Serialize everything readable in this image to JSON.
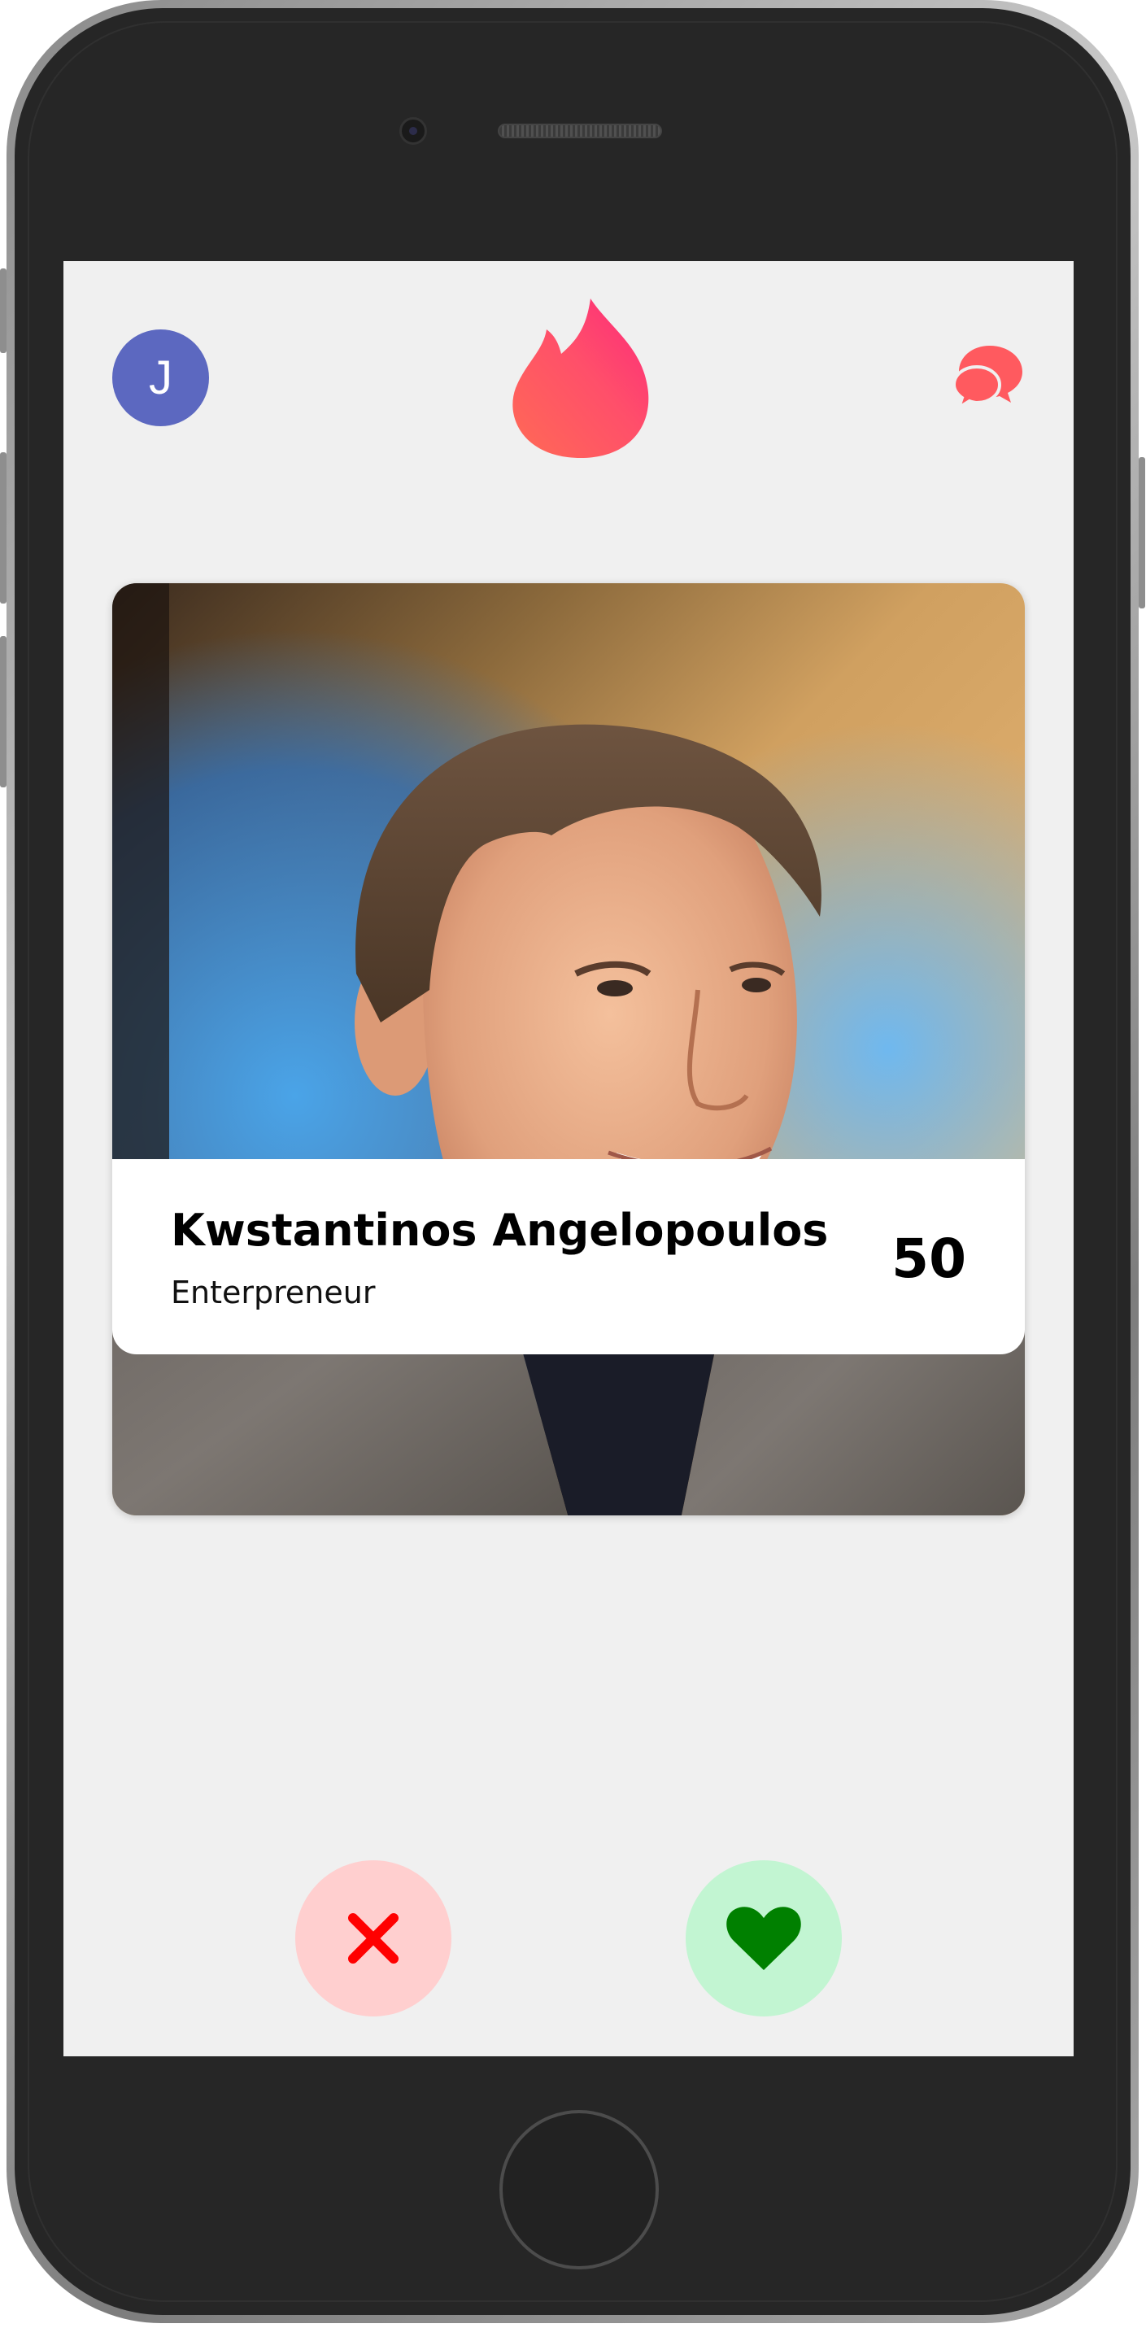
{
  "header": {
    "avatar_initial": "J",
    "logo_icon": "flame-icon",
    "messages_icon": "chat-bubbles-icon"
  },
  "card": {
    "name": "Kwstantinos Angelopoulos",
    "occupation": "Enterpreneur",
    "age": "50",
    "photo_icon": "profile-photo"
  },
  "actions": {
    "dislike_icon": "close-icon",
    "like_icon": "heart-icon"
  },
  "colors": {
    "avatar": "#5c68c0",
    "brand_start": "#fd297b",
    "brand_end": "#ff655b",
    "dislike_bg": "#ffcfcf",
    "dislike_icon": "#ff0000",
    "like_bg": "#c2f5d2",
    "like_icon": "#008000",
    "screen_bg": "#f0f0f0"
  }
}
